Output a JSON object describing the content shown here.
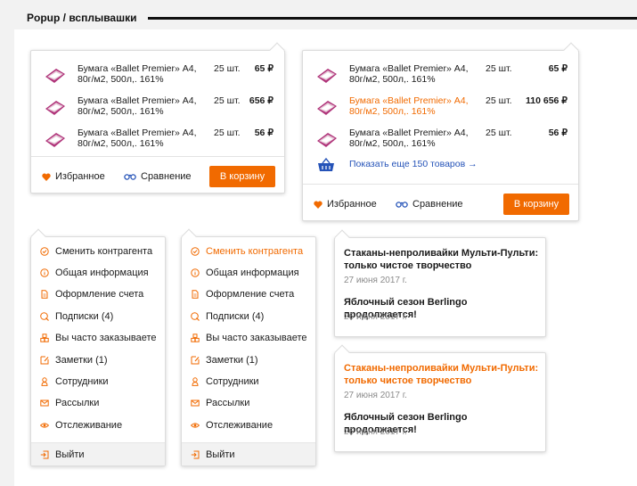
{
  "section_title": "Popup / всплывашки",
  "cart_popup_1": {
    "items": [
      {
        "name": "Бумага «Ballet Premier» А4, 80г/м2, 500л,. 161%",
        "qty": "25 шт.",
        "price": "65 ₽"
      },
      {
        "name": "Бумага «Ballet Premier» А4, 80г/м2, 500л,. 161%",
        "qty": "25 шт.",
        "price": "656 ₽"
      },
      {
        "name": "Бумага «Ballet Premier» А4, 80г/м2, 500л,. 161%",
        "qty": "25 шт.",
        "price": "56 ₽"
      }
    ],
    "favorites": "Избранное",
    "compare": "Сравнение",
    "to_cart": "В корзину"
  },
  "cart_popup_2": {
    "items": [
      {
        "name": "Бумага «Ballet Premier» А4, 80г/м2, 500л,. 161%",
        "qty": "25 шт.",
        "price": "65 ₽"
      },
      {
        "name": "Бумага «Ballet Premier» А4, 80г/м2, 500л,. 161%",
        "qty": "25 шт.",
        "price": "110 656 ₽"
      },
      {
        "name": "Бумага «Ballet Premier» А4, 80г/м2, 500л,. 161%",
        "qty": "25 шт.",
        "price": "56 ₽"
      }
    ],
    "show_more": "Показать еще 150 товаров →",
    "favorites": "Избранное",
    "compare": "Сравнение",
    "to_cart": "В корзину"
  },
  "account_menu": {
    "items": [
      {
        "label": "Сменить контрагента",
        "icon": "check-circle-icon"
      },
      {
        "label": "Общая информация",
        "icon": "info-icon"
      },
      {
        "label": "Оформление счета",
        "icon": "document-icon"
      },
      {
        "label": "Подписки (4)",
        "icon": "subscription-icon"
      },
      {
        "label": "Вы часто заказываете",
        "icon": "boxes-icon"
      },
      {
        "label": "Заметки (1)",
        "icon": "note-icon"
      },
      {
        "label": "Сотрудники",
        "icon": "person-icon"
      },
      {
        "label": "Рассылки",
        "icon": "mail-icon"
      },
      {
        "label": "Отслеживание",
        "icon": "eye-icon"
      }
    ],
    "logout": "Выйти"
  },
  "news_popup": {
    "items": [
      {
        "title": "Стаканы-непроливайки Мульти-Пульти: только чистое творчество",
        "date": "27 июня 2017 г."
      },
      {
        "title": "Яблочный сезон Berlingo продолжается!",
        "date": "26 июня 2017 г."
      }
    ]
  },
  "colors": {
    "accent": "#f16a00",
    "link": "#2553b8"
  }
}
